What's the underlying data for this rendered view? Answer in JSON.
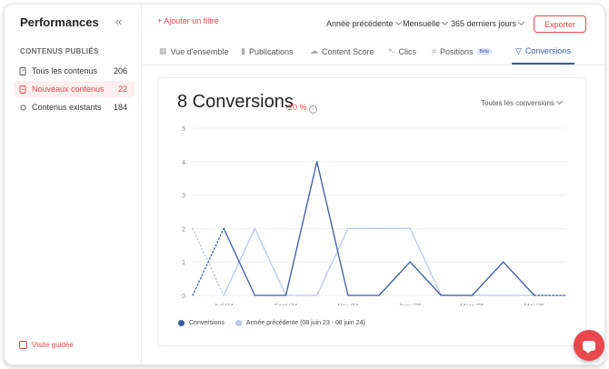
{
  "sidebar": {
    "title": "Performances",
    "collapse_icon": "double-chevron-left-icon",
    "section": "CONTENUS PUBLIÉS",
    "items": [
      {
        "label": "Tous les contenus",
        "count": "206",
        "icon": "file-icon"
      },
      {
        "label": "Nouveaux contenus",
        "count": "22",
        "icon": "new-file-icon"
      },
      {
        "label": "Contenus existants",
        "count": "184",
        "icon": "refresh-icon"
      }
    ],
    "guide": "Visite guidée"
  },
  "header": {
    "add_filter": "+ Ajouter un filtre",
    "compare": "Année précédente",
    "granularity": "Mensuelle",
    "period": "365 derniers jours",
    "export": "Exporter"
  },
  "tabs": [
    {
      "label": "Vue d'ensemble",
      "icon": "grid-icon"
    },
    {
      "label": "Publications",
      "icon": "bar-chart-icon"
    },
    {
      "label": "Content Score",
      "icon": "cloud-icon"
    },
    {
      "label": "Clics",
      "icon": "cursor-icon"
    },
    {
      "label": "Positions",
      "icon": "hash-icon",
      "badge": "Béta"
    },
    {
      "label": "Conversions",
      "icon": "filter-icon",
      "active": true
    }
  ],
  "card": {
    "kpi": "8 Conversions",
    "delta": "-20 %",
    "dropdown": "Toutes les conversions"
  },
  "chart_data": {
    "type": "line",
    "ylim": [
      0,
      5
    ],
    "yticks": [
      "0",
      "1",
      "2",
      "3",
      "4",
      "5"
    ],
    "xtick_labels": [
      "Juil '24",
      "Sept '24",
      "Nov '24",
      "Janv '25",
      "Mars '25",
      "Mai '25"
    ],
    "series": [
      {
        "name": "Conversions",
        "color": "#3b5aa6",
        "values": [
          0,
          2,
          0,
          0,
          4,
          0,
          0,
          1,
          0,
          0,
          1,
          0,
          0
        ]
      },
      {
        "name": "Année précédente (08 juin 23 - 08 juin 24)",
        "color": "#b9c7e6",
        "values": [
          2,
          0,
          2,
          0,
          0,
          2,
          2,
          2,
          0,
          0,
          0,
          0,
          0
        ]
      }
    ],
    "grid": true,
    "legend": "bottom-left"
  },
  "colors": {
    "accent": "#e8474c",
    "primary": "#3b5aa6",
    "secondary": "#b9c7e6"
  }
}
